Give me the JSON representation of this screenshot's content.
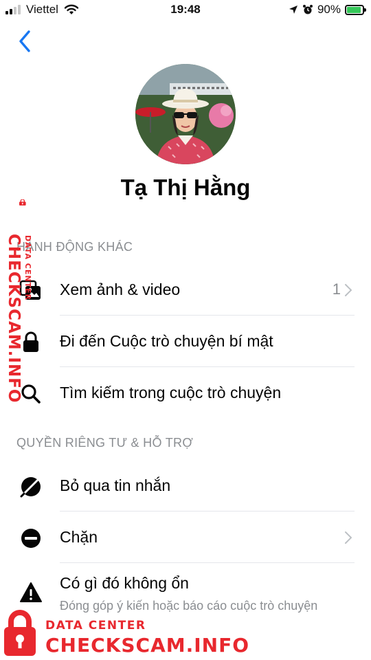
{
  "status_bar": {
    "carrier": "Viettel",
    "time": "19:48",
    "battery": "90%",
    "battery_level": 0.9,
    "signal_bars": 2,
    "icons": [
      "signal-icon",
      "wifi-icon",
      "location-icon",
      "alarm-icon",
      "battery-charging-icon"
    ]
  },
  "nav": {
    "back_icon": "chevron-left-icon"
  },
  "profile": {
    "name": "Tạ Thị Hằng",
    "avatar_icon": "profile-photo"
  },
  "sections": {
    "more_actions": {
      "title": "HÀNH ĐỘNG KHÁC",
      "items": [
        {
          "label": "Xem ảnh & video",
          "icon": "photos-icon",
          "count": "1",
          "chevron": true
        },
        {
          "label": "Đi đến Cuộc trò chuyện bí mật",
          "icon": "lock-icon"
        },
        {
          "label": "Tìm kiếm trong cuộc trò chuyện",
          "icon": "search-icon"
        }
      ]
    },
    "privacy": {
      "title": "QUYỀN RIÊNG TƯ & HỖ TRỢ",
      "items": [
        {
          "label": "Bỏ qua tin nhắn",
          "icon": "ignore-icon"
        },
        {
          "label": "Chặn",
          "icon": "block-icon",
          "chevron": true
        },
        {
          "label": "Có gì đó không ổn",
          "sublabel": "Đóng góp ý kiến hoặc báo cáo cuộc trò chuyện",
          "icon": "warning-icon"
        }
      ]
    }
  },
  "watermark": {
    "side_big": "CHECKSCAM.INFO",
    "side_small": "DATA CENTER",
    "bottom_small": "DATA CENTER",
    "bottom_big": "CHECKSCAM.INFO",
    "color": "#e8282e"
  },
  "colors": {
    "accent": "#1877f2",
    "secondary_text": "#8a8d91",
    "divider": "#e4e6eb"
  }
}
